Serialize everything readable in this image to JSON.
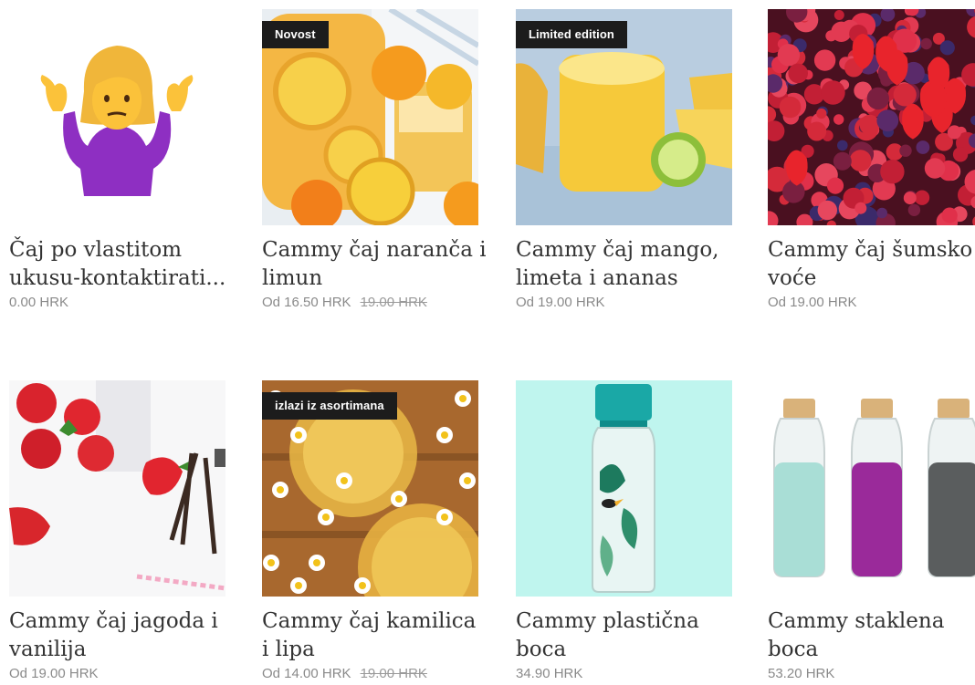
{
  "products": [
    {
      "name_line1": "Čaj po vlastitom",
      "name_line2": "ukusu-kontaktirati...",
      "price": "0.00 HRK",
      "old_price": "",
      "badge": "",
      "image": "shrugging-woman-emoji"
    },
    {
      "name_line1": "Cammy čaj naranča i",
      "name_line2": "limun",
      "price": "Od 16.50 HRK",
      "old_price": "19.00 HRK",
      "badge": "Novost",
      "image": "orange-lemon-drink"
    },
    {
      "name_line1": "Cammy čaj mango,",
      "name_line2": "limeta i ananas",
      "price": "Od 19.00 HRK",
      "old_price": "",
      "badge": "Limited edition",
      "image": "mango-drink"
    },
    {
      "name_line1": "Cammy čaj šumsko",
      "name_line2": "voće",
      "price": "Od 19.00 HRK",
      "old_price": "",
      "badge": "",
      "image": "forest-berries"
    },
    {
      "name_line1": "Cammy čaj jagoda i",
      "name_line2": "vanilija",
      "price": "Od 19.00 HRK",
      "old_price": "",
      "badge": "",
      "image": "strawberry-vanilla"
    },
    {
      "name_line1": "Cammy čaj kamilica",
      "name_line2": "i lipa",
      "price": "Od 14.00 HRK",
      "old_price": "19.00 HRK",
      "badge": "izlazi iz asortimana",
      "image": "chamomile-tea"
    },
    {
      "name_line1": "Cammy plastična",
      "name_line2": "boca",
      "price": "34.90 HRK",
      "old_price": "",
      "badge": "",
      "image": "plastic-bottle"
    },
    {
      "name_line1": "Cammy staklena",
      "name_line2": "boca",
      "price": "53.20 HRK",
      "old_price": "",
      "badge": "",
      "image": "glass-bottles"
    }
  ]
}
